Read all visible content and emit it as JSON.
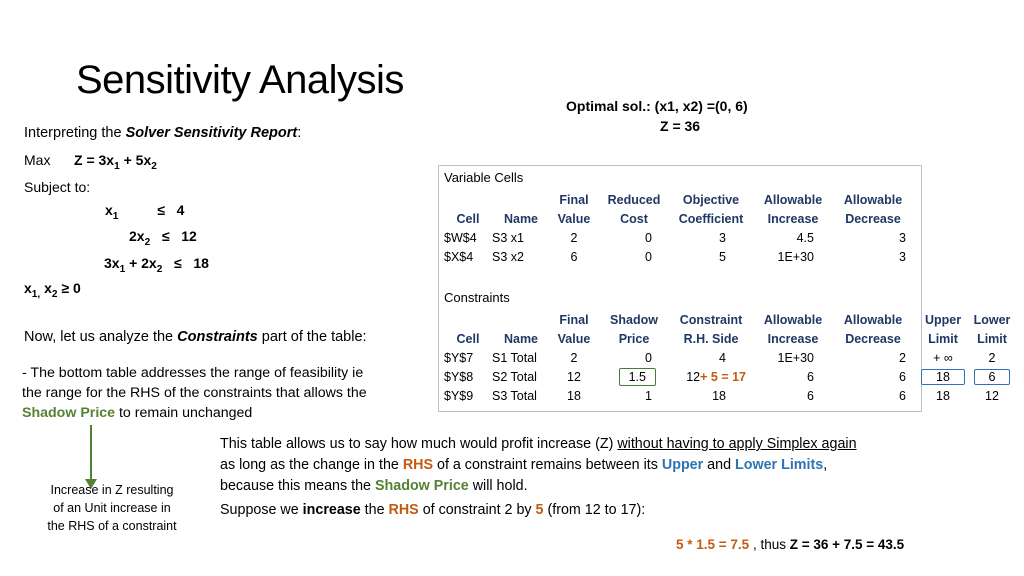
{
  "title": "Sensitivity Analysis",
  "intro": {
    "prefix": "Interpreting the ",
    "emph": "Solver Sensitivity Report",
    "suffix": ":"
  },
  "model": {
    "max_label": "Max",
    "objective": "Z = 3x1 + 5x2",
    "subject_to": "Subject to:",
    "constraint1": "x1      ≤   4",
    "constraint2": "2x2  ≤   12",
    "constraint3": "3x1 + 2x2   ≤   18",
    "nonneg": "x1, x2 ≥ 0"
  },
  "now_analyze": {
    "prefix": "Now, let us analyze the ",
    "emph": "Constraints",
    "suffix": " part of the table:"
  },
  "bottom_table_note": {
    "line1": "- The bottom table addresses the range of feasibility ie",
    "line2": "the range for the RHS of the constraints that allows the",
    "line3_green": "Shadow Price",
    "line3_rest": " to remain unchanged"
  },
  "arrow_caption": {
    "line1": "Increase in Z resulting",
    "line2": "of an Unit increase in",
    "line3": "the RHS of a constraint"
  },
  "optimal": {
    "solution": "Optimal sol.:  (x1, x2) =(0, 6)",
    "z": "Z = 36"
  },
  "report": {
    "variable_cells_label": "Variable Cells",
    "constraints_label": "Constraints",
    "variable_cells": {
      "headers_top": [
        "",
        "",
        "Final",
        "Reduced",
        "Objective",
        "Allowable",
        "Allowable"
      ],
      "headers_bottom": [
        "Cell",
        "Name",
        "Value",
        "Cost",
        "Coefficient",
        "Increase",
        "Decrease"
      ],
      "rows": [
        [
          "$W$4",
          "S3 x1",
          "2",
          "0",
          "3",
          "4.5",
          "3"
        ],
        [
          "$X$4",
          "S3 x2",
          "6",
          "0",
          "5",
          "1E+30",
          "3"
        ]
      ]
    },
    "constraints": {
      "headers_top": [
        "",
        "",
        "Final",
        "Shadow",
        "Constraint",
        "Allowable",
        "Allowable"
      ],
      "headers_bottom": [
        "Cell",
        "Name",
        "Value",
        "Price",
        "R.H. Side",
        "Increase",
        "Decrease"
      ],
      "rows": [
        {
          "cell": "$Y$7",
          "name": "S1 Total",
          "final": "2",
          "shadow": "0",
          "rhs": "4",
          "rhs_extra": "",
          "increase": "1E+30",
          "decrease": "2"
        },
        {
          "cell": "$Y$8",
          "name": "S2 Total",
          "final": "12",
          "shadow": "1.5",
          "rhs": "12",
          "rhs_extra": "+ 5 = 17",
          "increase": "6",
          "decrease": "6"
        },
        {
          "cell": "$Y$9",
          "name": "S3 Total",
          "final": "18",
          "shadow": "1",
          "rhs": "18",
          "rhs_extra": "",
          "increase": "6",
          "decrease": "6"
        }
      ]
    },
    "limits": {
      "upper_header": [
        "Upper",
        "Limit"
      ],
      "lower_header": [
        "Lower",
        "Limit"
      ],
      "rows": [
        {
          "upper": "+ ∞",
          "lower": "2"
        },
        {
          "upper": "18",
          "lower": "6"
        },
        {
          "upper": "18",
          "lower": "12"
        }
      ]
    }
  },
  "explanation": {
    "p1_a": "This table allows us to say how much would profit increase (Z) ",
    "p1_underline": "without having to apply Simplex again",
    "p1_b": "as long as the change in the ",
    "p1_rhs": "RHS",
    "p1_c": " of a constraint remains between its ",
    "p1_upper": "Upper",
    "p1_d": " and ",
    "p1_lower": "Lower Limits",
    "p1_e": ",",
    "p1_f": "because this means the ",
    "p1_shadow": "Shadow Price",
    "p1_g": " will hold.",
    "p2_a": "Suppose we ",
    "p2_increase": "increase",
    "p2_b": " the ",
    "p2_rhs": "RHS",
    "p2_c": " of constraint 2 by ",
    "p2_five": "5",
    "p2_d": " (from 12 to 17):",
    "p3_a": "5 * 1.5 = 7.5",
    "p3_b": " ,  thus  ",
    "p3_c": "Z = 36 + 7.5 = 43.5"
  },
  "colors": {
    "header_blue": "#1f3864",
    "green": "#548235",
    "orange": "#c55a11",
    "link_blue": "#2e74b5"
  }
}
